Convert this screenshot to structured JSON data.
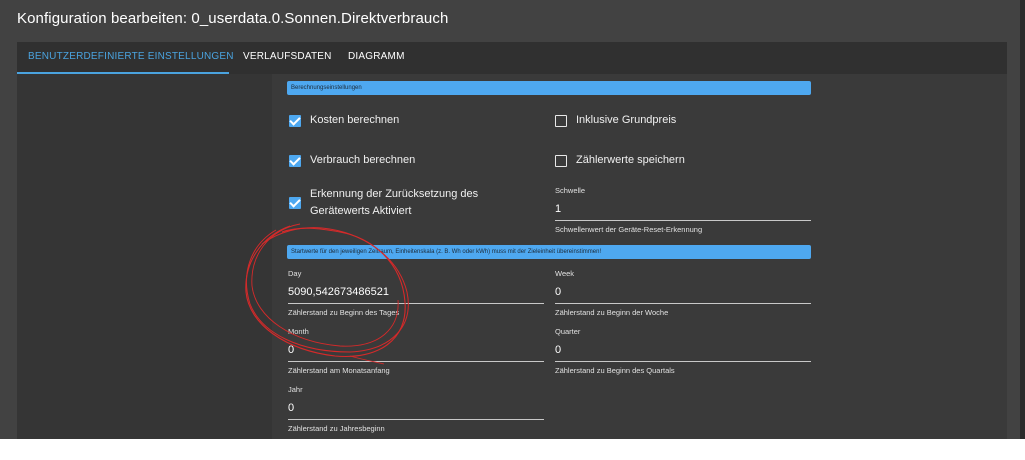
{
  "dialog": {
    "title": "Konfiguration bearbeiten: 0_userdata.0.Sonnen.Direktverbrauch"
  },
  "tabs": [
    {
      "label": "BENUTZERDEFINIERTE EINSTELLUNGEN",
      "active": true
    },
    {
      "label": "VERLAUFSDATEN",
      "active": false
    },
    {
      "label": "DIAGRAMM",
      "active": false
    }
  ],
  "calc_section": {
    "header": "Berechnungseinstellungen",
    "checkboxes": [
      {
        "label": "Kosten berechnen",
        "checked": true
      },
      {
        "label": "Inklusive Grundpreis",
        "checked": false
      },
      {
        "label": "Verbrauch berechnen",
        "checked": true
      },
      {
        "label": "Zählerwerte speichern",
        "checked": false
      },
      {
        "label": "Erkennung der Zurücksetzung des Gerätewerts Aktiviert",
        "checked": true
      }
    ],
    "threshold": {
      "label": "Schwelle",
      "value": "1",
      "helper": "Schwellenwert der Geräte-Reset-Erkennung"
    }
  },
  "start_section": {
    "header": "Startwerte für den jeweiligen Zeitraum, Einheitenskala (z. B. Wh oder kWh) muss mit der Zieleinheit übereinstimmen!",
    "fields": {
      "day": {
        "label": "Day",
        "value": "5090,542673486521",
        "helper": "Zählerstand zu Beginn des Tages"
      },
      "week": {
        "label": "Week",
        "value": "0",
        "helper": "Zählerstand zu Beginn der Woche"
      },
      "month": {
        "label": "Month",
        "value": "0",
        "helper": "Zählerstand am Monatsanfang"
      },
      "quarter": {
        "label": "Quarter",
        "value": "0",
        "helper": "Zählerstand zu Beginn des Quartals"
      },
      "year": {
        "label": "Jahr",
        "value": "0",
        "helper": "Zählerstand zu Jahresbeginn"
      }
    }
  },
  "colors": {
    "accent": "#4ea8f0",
    "tab_active": "#4aa3df",
    "dialog_bg": "#424242",
    "annotation": "#d42a2a"
  }
}
